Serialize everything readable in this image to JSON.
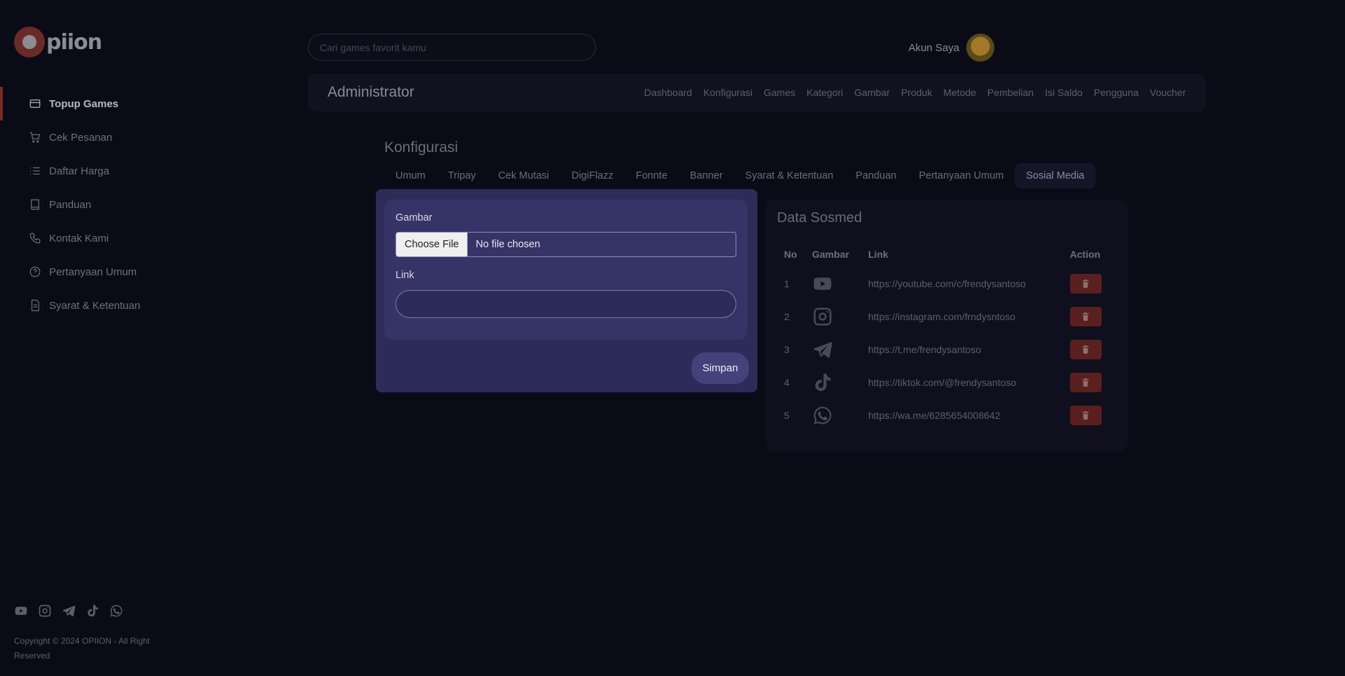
{
  "brand": {
    "logo_text": "piion"
  },
  "sidebar": {
    "items": [
      {
        "label": "Topup Games",
        "icon": "card-icon",
        "active": true
      },
      {
        "label": "Cek Pesanan",
        "icon": "cart-icon"
      },
      {
        "label": "Daftar Harga",
        "icon": "list-icon"
      },
      {
        "label": "Panduan",
        "icon": "book-icon"
      },
      {
        "label": "Kontak Kami",
        "icon": "phone-icon"
      },
      {
        "label": "Pertanyaan Umum",
        "icon": "question-icon"
      },
      {
        "label": "Syarat & Ketentuan",
        "icon": "document-icon"
      }
    ],
    "social_icons": [
      "youtube-icon",
      "instagram-icon",
      "telegram-icon",
      "tiktok-icon",
      "whatsapp-icon"
    ],
    "copyright": "Copyright © 2024 OPIION - All Right Reserved"
  },
  "topbar": {
    "search_placeholder": "Cari games favorit kamu",
    "account_label": "Akun Saya"
  },
  "admin": {
    "title": "Administrator",
    "links": [
      "Dashboard",
      "Konfigurasi",
      "Games",
      "Kategori",
      "Gambar",
      "Produk",
      "Metode",
      "Pembelian",
      "Isi Saldo",
      "Pengguna",
      "Voucher"
    ]
  },
  "page": {
    "title": "Konfigurasi",
    "tabs": [
      "Umum",
      "Tripay",
      "Cek Mutasi",
      "DigiFlazz",
      "Fonnte",
      "Banner",
      "Syarat & Ketentuan",
      "Panduan",
      "Pertanyaan Umum",
      "Sosial Media"
    ],
    "active_tab": "Sosial Media"
  },
  "form": {
    "image_label": "Gambar",
    "file_button": "Choose File",
    "file_status": "No file chosen",
    "link_label": "Link",
    "link_value": "",
    "save_label": "Simpan"
  },
  "sosmed": {
    "title": "Data Sosmed",
    "columns": [
      "No",
      "Gambar",
      "Link",
      "Action"
    ],
    "rows": [
      {
        "no": "1",
        "icon": "youtube-icon",
        "link": "https://youtube.com/c/frendysantoso"
      },
      {
        "no": "2",
        "icon": "instagram-icon",
        "link": "https://instagram.com/frndysntoso"
      },
      {
        "no": "3",
        "icon": "telegram-icon",
        "link": "https://t.me/frendysantoso"
      },
      {
        "no": "4",
        "icon": "tiktok-icon",
        "link": "https://tiktok.com/@frendysantoso"
      },
      {
        "no": "5",
        "icon": "whatsapp-icon",
        "link": "https://wa.me/6285654008642"
      }
    ]
  },
  "colors": {
    "background": "#0b0b18",
    "modal": "#2d2b57",
    "accent_red": "#7a2a27",
    "delete_button": "#5a1f1f"
  }
}
